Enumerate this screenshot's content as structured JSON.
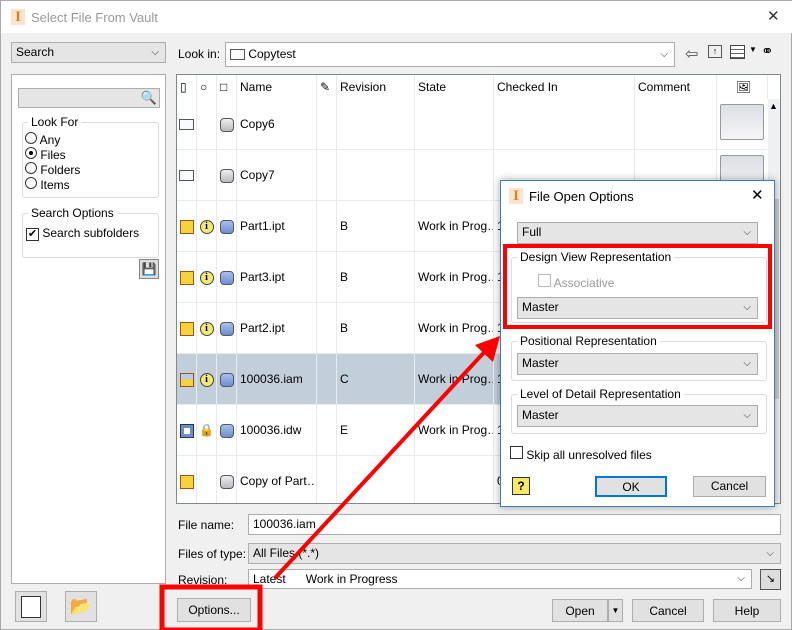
{
  "window": {
    "title": "Select File From Vault",
    "close": "✕"
  },
  "sidebar": {
    "mode": "Search",
    "search_placeholder": "",
    "look_for_label": "Look For",
    "look_for": [
      {
        "label": "Any",
        "selected": false
      },
      {
        "label": "Files",
        "selected": true
      },
      {
        "label": "Folders",
        "selected": false
      },
      {
        "label": "Items",
        "selected": false
      }
    ],
    "search_options_label": "Search Options",
    "search_subfolders": {
      "label": "Search subfolders",
      "checked": true
    }
  },
  "lookin": {
    "label": "Look in:",
    "value": "Copytest"
  },
  "grid": {
    "headers": {
      "name": "Name",
      "revision": "Revision",
      "state": "State",
      "checked_in": "Checked In",
      "comment": "Comment"
    },
    "rows": [
      {
        "type": "folder",
        "info": "",
        "status": "gray",
        "name": "Copy6",
        "revision": "",
        "state": "",
        "checked_in": "",
        "selected": false
      },
      {
        "type": "folder",
        "info": "",
        "status": "gray",
        "name": "Copy7",
        "revision": "",
        "state": "",
        "checked_in": "",
        "selected": false
      },
      {
        "type": "part",
        "info": "i",
        "status": "blue",
        "name": "Part1.ipt",
        "revision": "B",
        "state": "Work in Prog…",
        "checked_in": "1",
        "selected": false
      },
      {
        "type": "part",
        "info": "i",
        "status": "blue",
        "name": "Part3.ipt",
        "revision": "B",
        "state": "Work in Prog…",
        "checked_in": "1",
        "selected": false
      },
      {
        "type": "part",
        "info": "i",
        "status": "blue",
        "name": "Part2.ipt",
        "revision": "B",
        "state": "Work in Prog…",
        "checked_in": "1",
        "selected": false
      },
      {
        "type": "assembly",
        "info": "i",
        "status": "blue",
        "name": "100036.iam",
        "revision": "C",
        "state": "Work in Prog…",
        "checked_in": "1",
        "selected": true
      },
      {
        "type": "drawing",
        "info": "lock",
        "status": "blue",
        "name": "100036.idw",
        "revision": "E",
        "state": "Work in Prog…",
        "checked_in": "1",
        "selected": false
      },
      {
        "type": "part",
        "info": "",
        "status": "gray",
        "name": "Copy of Part…",
        "revision": "",
        "state": "",
        "checked_in": "0",
        "selected": false
      }
    ]
  },
  "bottom": {
    "file_name_label": "File name:",
    "file_name": "100036.iam",
    "files_of_type_label": "Files of type:",
    "files_of_type": "All Files (*.*)",
    "revision_label": "Revision:",
    "revision_value": "Latest",
    "revision_state": "Work in Progress",
    "options": "Options...",
    "open": "Open",
    "cancel": "Cancel",
    "help": "Help"
  },
  "dialog": {
    "title": "File Open Options",
    "close": "✕",
    "mode": "Full",
    "design_view_label": "Design View Representation",
    "associative": "Associative",
    "design_view": "Master",
    "positional_label": "Positional Representation",
    "positional": "Master",
    "lod_label": "Level of Detail Representation",
    "lod": "Master",
    "skip_label": "Skip all unresolved files",
    "help_icon": "?",
    "ok": "OK",
    "cancel": "Cancel"
  },
  "annotation_color": "#ff0000"
}
